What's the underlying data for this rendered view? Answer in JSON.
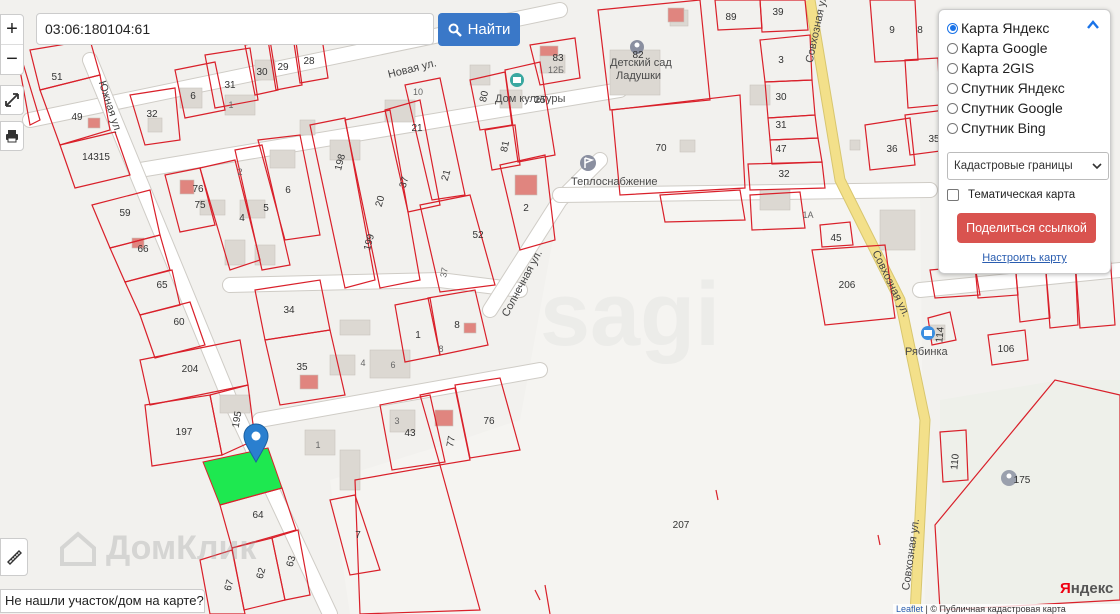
{
  "search": {
    "value": "03:06:180104:61",
    "button_label": "Найти"
  },
  "controls": {
    "zoom_in": "+",
    "zoom_out": "−"
  },
  "not_found_text": "Не нашли участок/дом на карте?",
  "panel": {
    "layers": [
      {
        "label": "Карта Яндекс",
        "selected": true
      },
      {
        "label": "Карта Google",
        "selected": false
      },
      {
        "label": "Карта 2GIS",
        "selected": false
      },
      {
        "label": "Спутник Яндекс",
        "selected": false
      },
      {
        "label": "Спутник Google",
        "selected": false
      },
      {
        "label": "Спутник Bing",
        "selected": false
      }
    ],
    "overlay_select": "Кадастровые границы",
    "thematic_label": "Тематическая карта",
    "share_label": "Поделиться ссылкой",
    "customize_label": "Настроить карту"
  },
  "map": {
    "streets": {
      "yuzhnaya": "Южная ул.",
      "novaya": "Новая ул.",
      "solnechnaya": "Солнечная ул.",
      "sovkhoznaya_top": "Совхозная ул.",
      "sovkhoznaya_mid": "Совхозная ул.",
      "sovkhoznaya_bottom": "Совхозная ул."
    },
    "pois": {
      "kindergarten_1": "Детский сад",
      "kindergarten_2": "Ладушки",
      "dom_kultury": "Дом культуры",
      "teplosnabzhenie": "Теплоснабжение",
      "ryabinka": "Рябинка"
    },
    "parcel_numbers": {
      "p51": "51",
      "p49": "49",
      "p14315": "14315",
      "p32": "32",
      "p6a": "6",
      "p31": "31",
      "p30": "30",
      "p29": "29",
      "p28": "28",
      "p59": "59",
      "p66": "66",
      "p65": "65",
      "p60": "60",
      "p204": "204",
      "p197": "197",
      "p195": "195",
      "p64": "64",
      "p62": "62",
      "p63": "63",
      "p67": "67",
      "p76": "76",
      "p75": "75",
      "p4": "4",
      "p5": "5",
      "p6b": "6",
      "p198": "198",
      "p20": "20",
      "p37a": "37",
      "p199": "199",
      "p21a": "21",
      "p21b": "21",
      "p10": "10",
      "p80": "80",
      "p81": "81",
      "p25": "25",
      "p83": "83",
      "p12b": "12Б",
      "p52": "52",
      "p2": "2",
      "p37b": "37",
      "p34": "34",
      "p35": "35",
      "p1a": "1",
      "p8": "8",
      "p43": "43",
      "p77": "77",
      "p76b": "76",
      "p1b": "1",
      "p7": "7",
      "p207": "207",
      "p82": "82",
      "p70": "70",
      "p89": "89",
      "p39": "39",
      "p3": "3",
      "p30b": "30",
      "p31b": "31",
      "p47": "47",
      "p32b": "32",
      "p1a_lbl": "1А",
      "p45": "45",
      "p206": "206",
      "p114": "114",
      "p106": "106",
      "p110": "110",
      "p175": "175",
      "p9": "9",
      "p8b": "8",
      "p36": "36",
      "p35b": "35"
    },
    "house_numbers": {
      "h1": "1",
      "h4": "4",
      "h6": "6",
      "h3": "3",
      "h8": "8",
      "h2": "2"
    },
    "watermark": "ДомКлик",
    "watermark_center": "sagi"
  },
  "attribution": {
    "leaflet": "Leaflet",
    "rest": "| © Публичная кадастровая карта"
  },
  "yandex_logo": {
    "first": "Я",
    "rest": "ндекс"
  },
  "colors": {
    "parcel_border": "#d9202a",
    "selected_parcel": "#1ee850",
    "find_button": "#3a78c8",
    "share_button": "#d9534f",
    "marker": "#2a7fcf"
  }
}
